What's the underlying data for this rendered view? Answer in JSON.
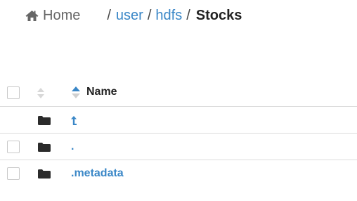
{
  "breadcrumb": {
    "home_label": "Home",
    "separator": "/",
    "segments": [
      "user",
      "hdfs"
    ],
    "current": "Stocks"
  },
  "table": {
    "header": {
      "name_label": "Name"
    },
    "rows": [
      {
        "type": "parent",
        "icon": "level-up-icon"
      },
      {
        "type": "folder",
        "name": "."
      },
      {
        "type": "folder",
        "name": ".metadata"
      }
    ]
  },
  "colors": {
    "link": "#3a87c7",
    "home": "#666666",
    "active_sort": "#3a87c7",
    "inactive_sort": "#d0d0d0"
  }
}
